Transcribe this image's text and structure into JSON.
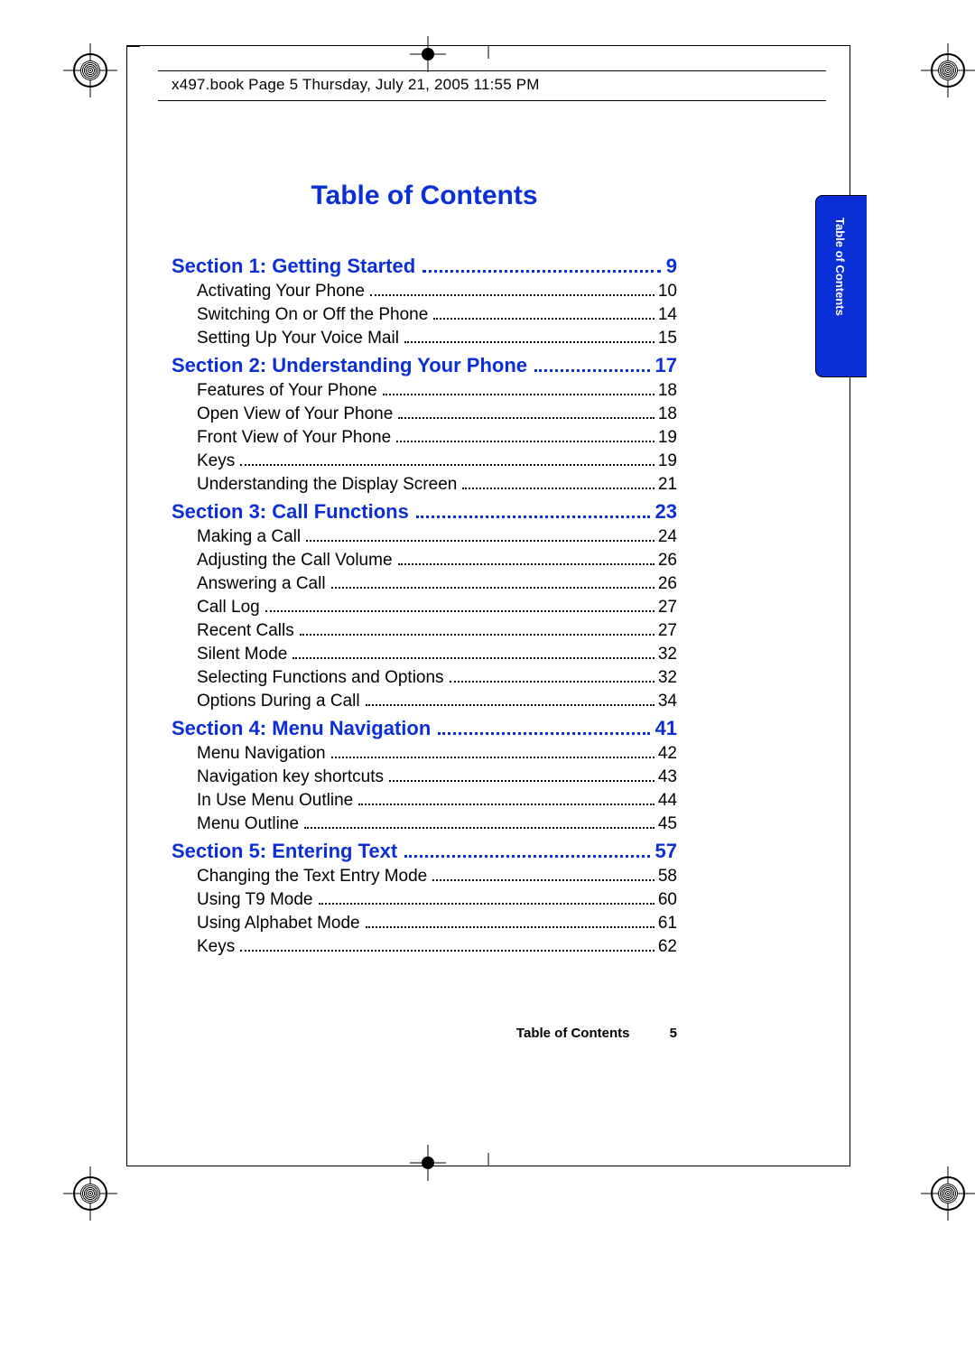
{
  "header": "x497.book  Page 5  Thursday, July 21, 2005  11:55 PM",
  "title": "Table of Contents",
  "side_tab": "Table of Contents",
  "footer": {
    "label": "Table of Contents",
    "page": "5"
  },
  "sections": [
    {
      "heading": "Section 1: Getting Started",
      "page": "9",
      "entries": [
        {
          "label": "Activating Your Phone",
          "page": "10"
        },
        {
          "label": "Switching On or Off the Phone",
          "page": "14"
        },
        {
          "label": "Setting Up Your Voice Mail",
          "page": "15"
        }
      ]
    },
    {
      "heading": "Section 2: Understanding Your Phone",
      "page": "17",
      "entries": [
        {
          "label": "Features of Your Phone",
          "page": "18"
        },
        {
          "label": "Open View of Your Phone",
          "page": "18"
        },
        {
          "label": "Front View of Your Phone",
          "page": "19"
        },
        {
          "label": "Keys",
          "page": "19"
        },
        {
          "label": "Understanding the Display Screen",
          "page": "21"
        }
      ]
    },
    {
      "heading": "Section 3: Call Functions",
      "page": "23",
      "entries": [
        {
          "label": "Making a Call",
          "page": "24"
        },
        {
          "label": "Adjusting the Call Volume",
          "page": "26"
        },
        {
          "label": "Answering a Call",
          "page": "26"
        },
        {
          "label": "Call Log",
          "page": "27"
        },
        {
          "label": "Recent Calls",
          "page": "27"
        },
        {
          "label": "Silent Mode",
          "page": "32"
        },
        {
          "label": "Selecting Functions and Options",
          "page": "32"
        },
        {
          "label": "Options During a Call",
          "page": "34"
        }
      ]
    },
    {
      "heading": "Section 4: Menu Navigation",
      "page": "41",
      "entries": [
        {
          "label": "Menu Navigation",
          "page": "42"
        },
        {
          "label": "Navigation key shortcuts",
          "page": "43"
        },
        {
          "label": "In Use Menu Outline",
          "page": "44"
        },
        {
          "label": "Menu Outline",
          "page": "45"
        }
      ]
    },
    {
      "heading": "Section 5: Entering Text",
      "page": "57",
      "entries": [
        {
          "label": "Changing the Text Entry Mode",
          "page": "58"
        },
        {
          "label": "Using T9 Mode",
          "page": "60"
        },
        {
          "label": "Using Alphabet Mode",
          "page": "61"
        },
        {
          "label": "Keys",
          "page": "62"
        }
      ]
    }
  ]
}
